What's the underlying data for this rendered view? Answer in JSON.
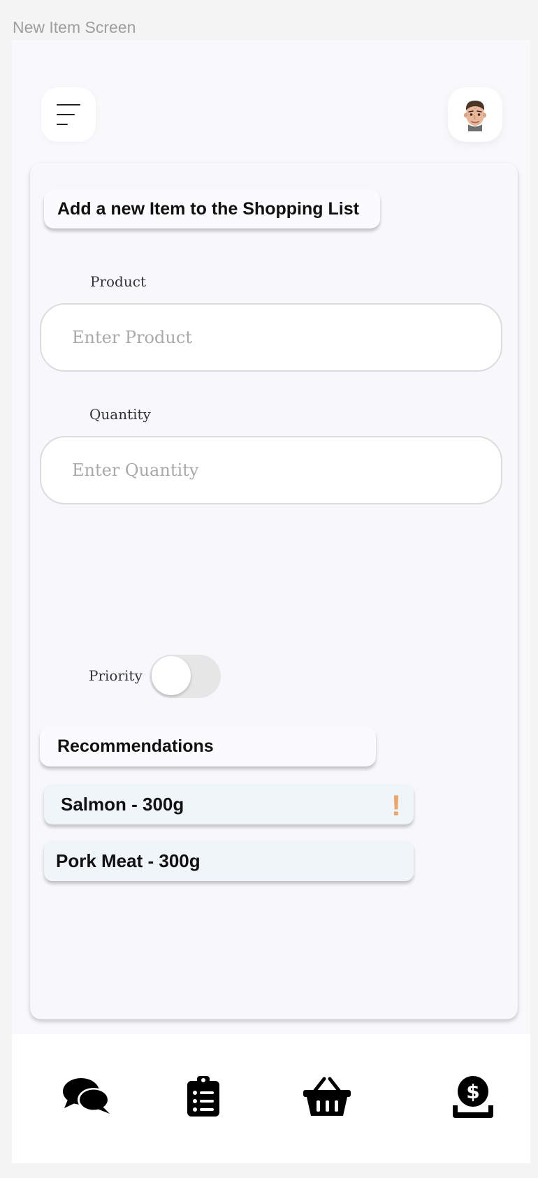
{
  "screen_label": "New Item Screen",
  "header": {
    "menu_icon": "hamburger-menu-icon",
    "avatar": "user-avatar-memoji"
  },
  "form": {
    "title": "Add a new Item to the Shopping List",
    "product": {
      "label": "Product",
      "placeholder": "Enter Product",
      "value": ""
    },
    "quantity": {
      "label": "Quantity",
      "placeholder": "Enter Quantity",
      "value": ""
    },
    "priority": {
      "label": "Priority",
      "enabled": false
    }
  },
  "recommendations": {
    "title": "Recommendations",
    "items": [
      {
        "label": "Salmon - 300g",
        "priority_flag": "!",
        "flag_color": "#eba56b"
      },
      {
        "label": "Pork Meat - 300g"
      }
    ]
  },
  "bottom_nav": {
    "items": [
      {
        "icon": "chat-bubbles-icon"
      },
      {
        "icon": "clipboard-list-icon"
      },
      {
        "icon": "shopping-basket-icon"
      },
      {
        "icon": "dollar-coin-hand-icon"
      }
    ]
  }
}
